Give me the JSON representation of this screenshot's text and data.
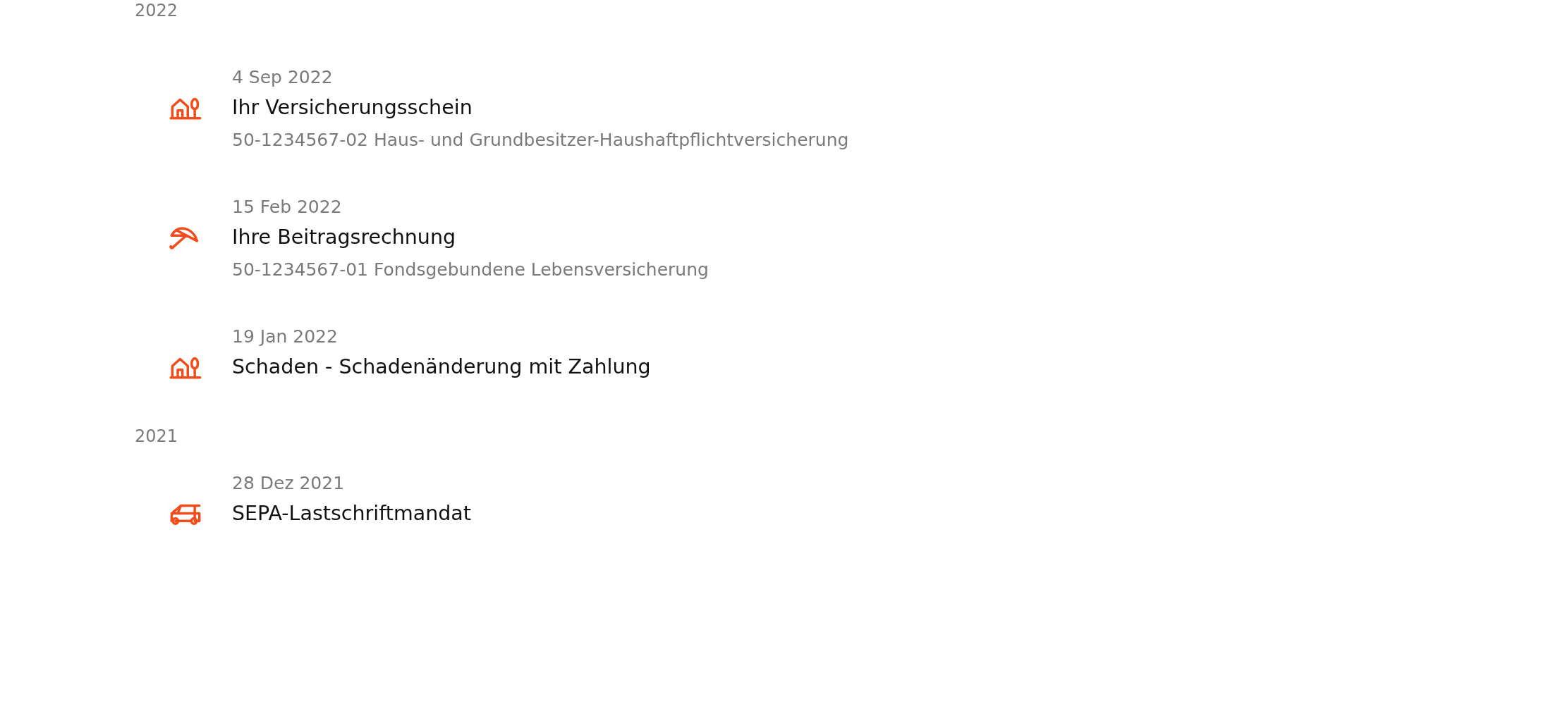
{
  "groups": [
    {
      "year": "2022",
      "items": [
        {
          "kind": "house",
          "date": "4 Sep 2022",
          "title": "Ihr Versicherungsschein",
          "subtitle": "50-1234567-02 Haus- und Grundbesitzer-Haushaftpflichtversicherung"
        },
        {
          "kind": "umbrella",
          "date": "15 Feb 2022",
          "title": "Ihre Beitragsrechnung",
          "subtitle": "50-1234567-01 Fondsgebundene Lebensversicherung"
        },
        {
          "kind": "house",
          "date": "19 Jan 2022",
          "title": "Schaden - Schadenänderung mit Zahlung"
        }
      ]
    },
    {
      "year": "2021",
      "items": [
        {
          "kind": "car",
          "date": "28 Dez 2021",
          "title": "SEPA-Lastschriftmandat"
        }
      ]
    }
  ]
}
